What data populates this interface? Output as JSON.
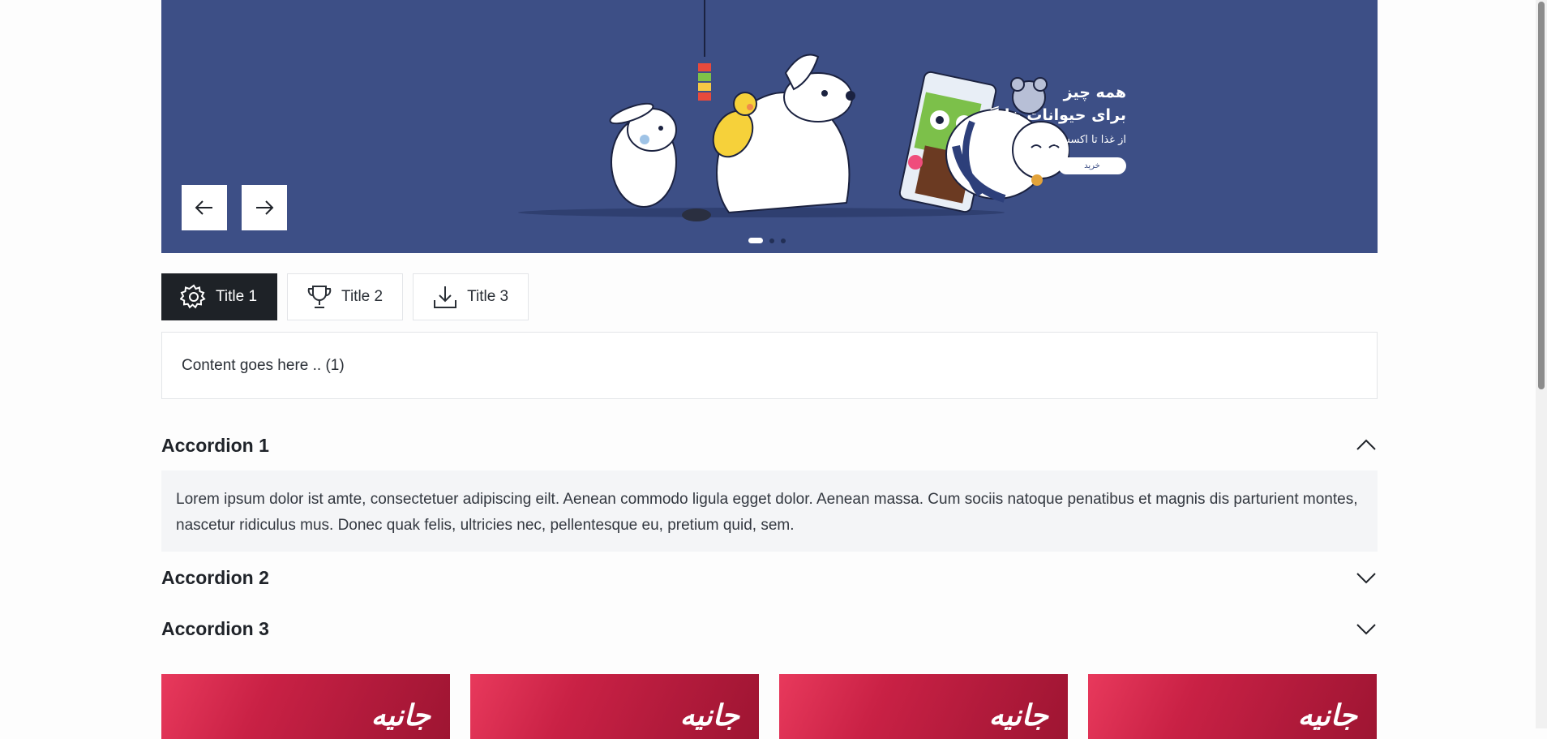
{
  "hero": {
    "line1": "همه چیز",
    "line2": "برای حیوانات خانگی",
    "line3": "از غذا تا اکسسوری",
    "cta_label": "خرید",
    "prev_icon": "arrow-left-icon",
    "next_icon": "arrow-right-icon",
    "slides_count": 3,
    "active_slide": 1,
    "background": "#3d4f86"
  },
  "tabs": [
    {
      "label": "Title 1",
      "icon": "gear-icon",
      "active": true
    },
    {
      "label": "Title 2",
      "icon": "trophy-icon",
      "active": false
    },
    {
      "label": "Title 3",
      "icon": "download-icon",
      "active": false
    }
  ],
  "tab_content": "Content goes here .. (1)",
  "accordions": [
    {
      "title": "Accordion 1",
      "expanded": true,
      "body": "Lorem ipsum dolor ist amte, consectetuer adipiscing eilt. Aenean commodo ligula egget dolor. Aenean massa. Cum sociis natoque penatibus et magnis dis parturient montes, nascetur ridiculus mus. Donec quak felis, ultricies nec, pellentesque eu, pretium quid, sem."
    },
    {
      "title": "Accordion 2",
      "expanded": false
    },
    {
      "title": "Accordion 3",
      "expanded": false
    }
  ],
  "promo_cards": [
    {
      "logo": "جانیه"
    },
    {
      "logo": "جانیه"
    },
    {
      "logo": "جانیه"
    },
    {
      "logo": "جانیه"
    }
  ],
  "colors": {
    "accent_dark": "#1e2227",
    "card_red": "#c92145"
  }
}
